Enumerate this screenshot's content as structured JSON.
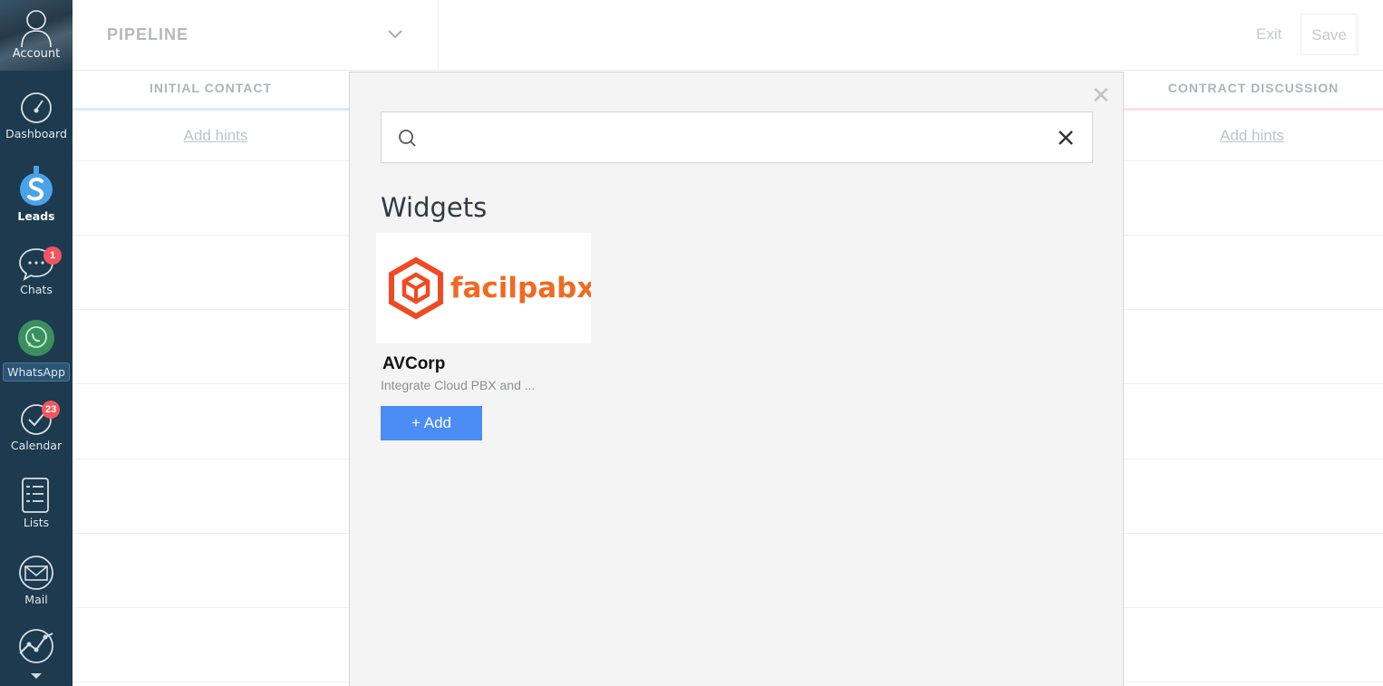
{
  "sidebar": {
    "account_label": "Account",
    "items": [
      {
        "label": "Dashboard"
      },
      {
        "label": "Leads"
      },
      {
        "label": "Chats",
        "badge": "1"
      },
      {
        "label": "WhatsApp"
      },
      {
        "label": "Calendar",
        "badge": "23"
      },
      {
        "label": "Lists"
      },
      {
        "label": "Mail"
      }
    ]
  },
  "header": {
    "pipeline_title": "PIPELINE",
    "exit_label": "Exit",
    "save_label": "Save"
  },
  "stages": [
    {
      "name": "INITIAL CONTACT",
      "hint": "Add hints",
      "color": "#cfe6fb"
    },
    {
      "name": "CONTRACT DISCUSSION",
      "hint": "Add hints",
      "color": "#fcd3d3"
    }
  ],
  "modal": {
    "search_placeholder": "",
    "section_title": "Widgets",
    "widget": {
      "logo_text": "facilpabx",
      "name": "AVCorp",
      "description": "Integrate Cloud PBX and ...",
      "add_label": "+ Add"
    }
  },
  "colors": {
    "sidebar_bg": "#1d3a4f",
    "badge": "#f2555f",
    "add_button": "#4b8df5",
    "logo": "#ef4a23"
  }
}
